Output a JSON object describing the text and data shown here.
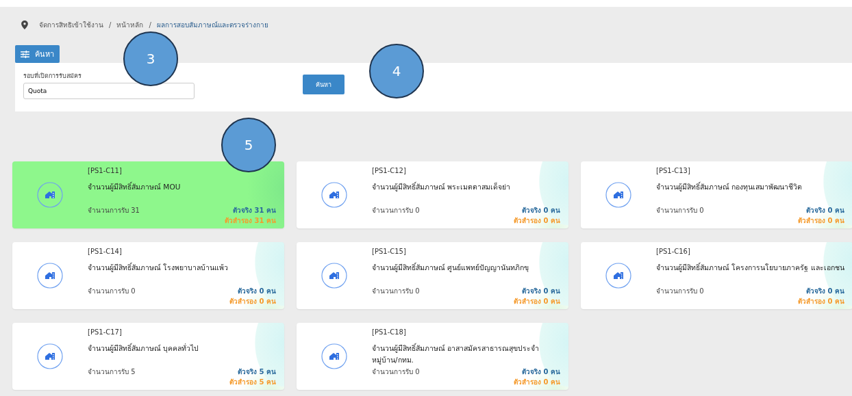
{
  "breadcrumb": [
    {
      "label": "จัดการสิทธิเข้าใช้งาน",
      "current": false
    },
    {
      "label": "หน้าหลัก",
      "current": false
    },
    {
      "label": "ผลการสอบสัมภาษณ์และตรวจร่างกาย",
      "current": true
    }
  ],
  "breadcrumb_separator": "/",
  "filter": {
    "tab_label": "ค้นหา",
    "field_label": "รอบที่เปิดการรับสมัคร",
    "field_value": "Quota",
    "search_button": "ค้นหา"
  },
  "callouts": [
    "3",
    "4",
    "5"
  ],
  "cards": [
    {
      "code": "[PS1-C11]",
      "title": "จำนวนผู้มีสิทธิ์สัมภาษณ์ MOU",
      "quota": "จำนวนการรับ 31",
      "actual": "ตัวจริง 31 คน",
      "reserve": "ตัวสำรอง 31 คน",
      "selected": true
    },
    {
      "code": "[PS1-C12]",
      "title": "จำนวนผู้มีสิทธิ์สัมภาษณ์ พระเมตตาสมเด็จย่า",
      "quota": "จำนวนการรับ 0",
      "actual": "ตัวจริง 0 คน",
      "reserve": "ตัวสำรอง 0 คน",
      "selected": false
    },
    {
      "code": "[PS1-C13]",
      "title": "จำนวนผู้มีสิทธิ์สัมภาษณ์ กองทุนเสมาพัฒนาชีวิต",
      "quota": "จำนวนการรับ 0",
      "actual": "ตัวจริง 0 คน",
      "reserve": "ตัวสำรอง 0 คน",
      "selected": false
    },
    {
      "code": "[PS1-C14]",
      "title": "จำนวนผู้มีสิทธิ์สัมภาษณ์ โรงพยาบาลบ้านแพ้ว",
      "quota": "จำนวนการรับ 0",
      "actual": "ตัวจริง 0 คน",
      "reserve": "ตัวสำรอง 0 คน",
      "selected": false
    },
    {
      "code": "[PS1-C15]",
      "title": "จำนวนผู้มีสิทธิ์สัมภาษณ์ ศูนย์แพทย์ปัญญานันทภิกขุ",
      "quota": "จำนวนการรับ 0",
      "actual": "ตัวจริง 0 คน",
      "reserve": "ตัวสำรอง 0 คน",
      "selected": false
    },
    {
      "code": "[PS1-C16]",
      "title": "จำนวนผู้มีสิทธิ์สัมภาษณ์ โครงการนโยบายภาครัฐ และเอกชน",
      "quota": "จำนวนการรับ 0",
      "actual": "ตัวจริง 0 คน",
      "reserve": "ตัวสำรอง 0 คน",
      "selected": false
    },
    {
      "code": "[PS1-C17]",
      "title": "จำนวนผู้มีสิทธิ์สัมภาษณ์ บุคคลทั่วไป",
      "quota": "จำนวนการรับ 5",
      "actual": "ตัวจริง 5 คน",
      "reserve": "ตัวสำรอง 5 คน",
      "selected": false
    },
    {
      "code": "[PS1-C18]",
      "title": "จำนวนผู้มีสิทธิ์สัมภาษณ์ อาสาสมัครสาธารณสุขประจำหมู่บ้าน/กทม.",
      "quota": "จำนวนการรับ 0",
      "actual": "ตัวจริง 0 คน",
      "reserve": "ตัวสำรอง 0 คน",
      "selected": false
    }
  ]
}
